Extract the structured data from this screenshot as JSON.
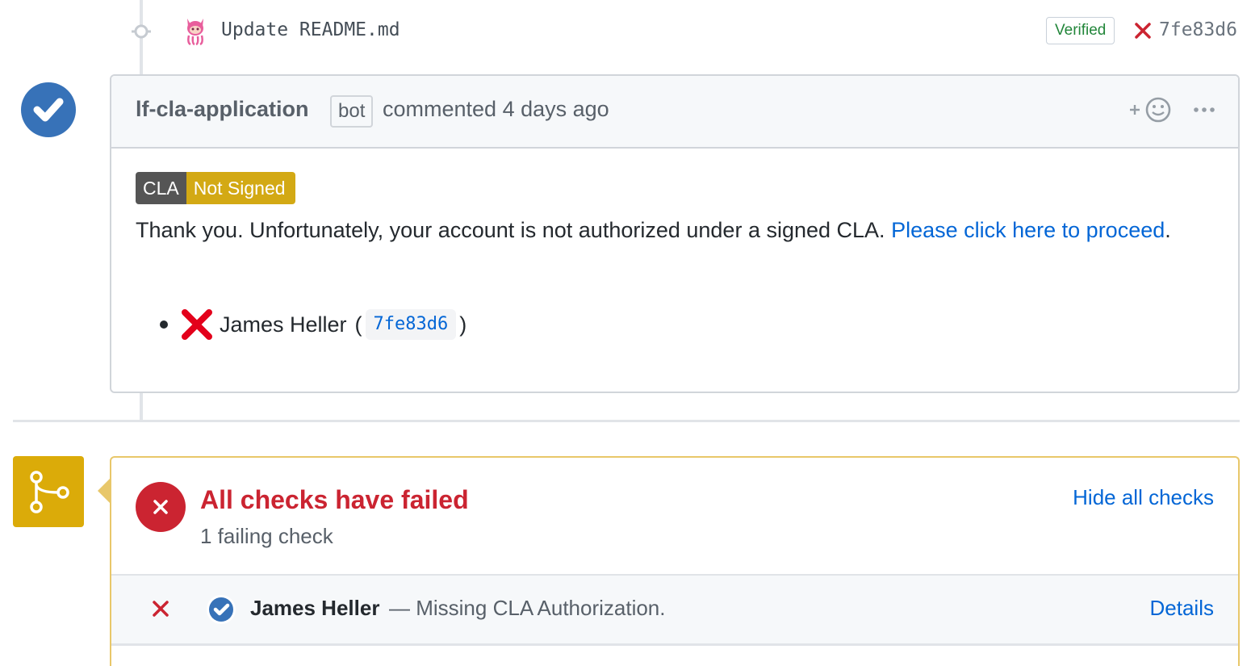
{
  "commit": {
    "message": "Update README.md",
    "verified_label": "Verified",
    "sha": "7fe83d6",
    "avatar_icon": "octocat-avatar-icon",
    "status_icon": "x-icon"
  },
  "comment": {
    "author": "lf-cla-application",
    "bot_label": "bot",
    "meta": "commented 4 days ago",
    "reaction_icon": "add-reaction-icon",
    "more_icon": "kebab-horizontal-icon",
    "badge": {
      "left": "CLA",
      "right": "Not Signed"
    },
    "text_before": "Thank you. Unfortunately, your account is not authorized under a signed CLA. ",
    "link_text": "Please click here to proceed",
    "text_after": ".",
    "list": [
      {
        "name": "James Heller",
        "open_paren": "(",
        "sha": "7fe83d6",
        "close_paren": ")"
      }
    ]
  },
  "checks": {
    "title": "All checks have failed",
    "subtitle": "1 failing check",
    "toggle_label": "Hide all checks",
    "rows": [
      {
        "name": "James Heller",
        "description": "— Missing CLA Authorization.",
        "details_label": "Details"
      }
    ]
  },
  "colors": {
    "fail_red": "#cb2431",
    "link_blue": "#0366d6",
    "pending_yellow": "#dbab09",
    "verified_green": "#22863a",
    "bot_blue": "#3772b8"
  }
}
